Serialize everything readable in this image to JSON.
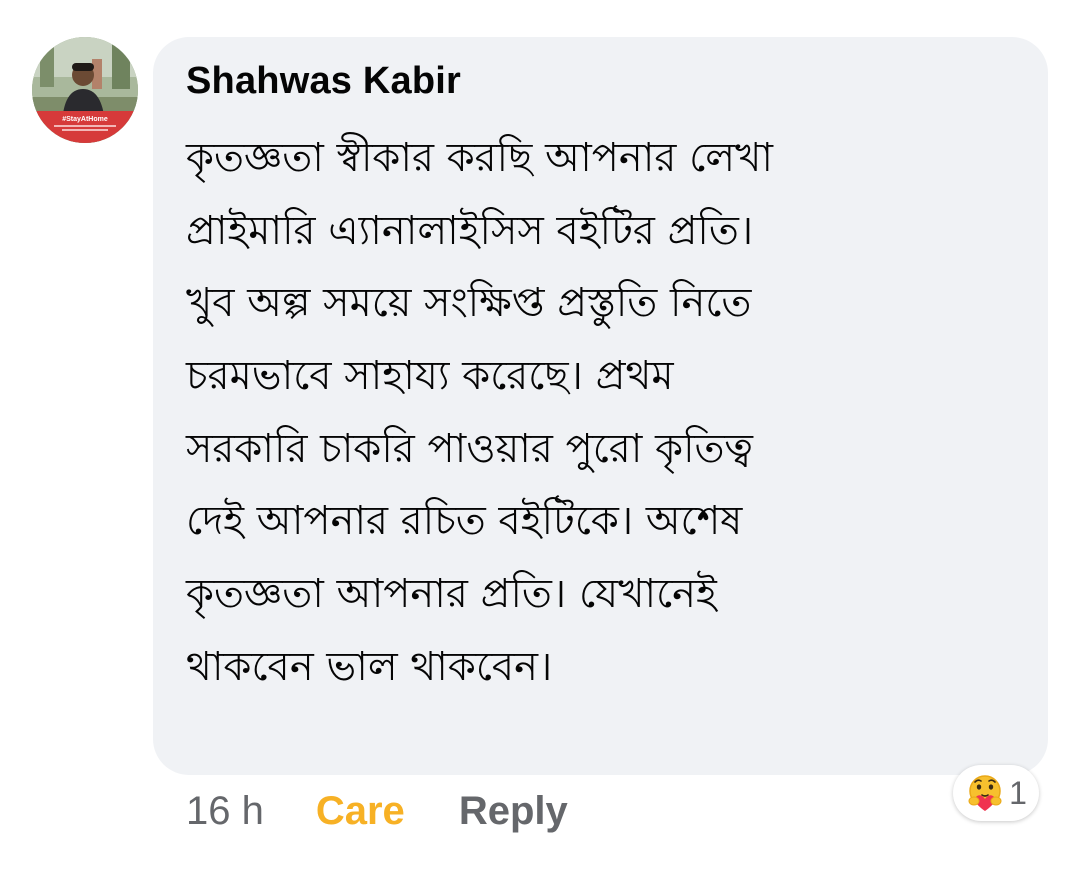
{
  "comment": {
    "author": "Shahwas Kabir",
    "avatar_badge": "#StayAtHome",
    "lines": [
      "কৃতজ্ঞতা স্বীকার করছি আপনার লেখা",
      "প্রাইমারি এ্যানালাইসিস বইটির প্রতি।",
      "খুব অল্প সময়ে সংক্ষিপ্ত প্রস্তুতি নিতে",
      "চরমভাবে সাহায্য করেছে। প্রথম",
      "সরকারি চাকরি পাওয়ার পুরো কৃতিত্ব",
      "দেই আপনার রচিত বইটিকে। অশেষ",
      "কৃতজ্ঞতা আপনার প্রতি। যেখানেই",
      "থাকবেন ভাল থাকবেন।"
    ]
  },
  "actions": {
    "timestamp": "16 h",
    "care_label": "Care",
    "reply_label": "Reply"
  },
  "reaction": {
    "icon": "care-emoji-icon",
    "count": "1"
  },
  "colors": {
    "bubble": "#f0f2f5",
    "care": "#f7b125",
    "secondary_text": "#65676b",
    "primary_text": "#050505",
    "avatar_badge": "#d63a3a"
  }
}
